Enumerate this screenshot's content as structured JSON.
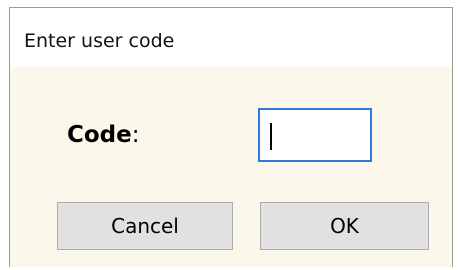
{
  "window": {
    "title": "Enter user code"
  },
  "form": {
    "code_label": "Code",
    "code_label_suffix": ":",
    "code_value": ""
  },
  "buttons": {
    "cancel_label": "Cancel",
    "ok_label": "OK"
  },
  "colors": {
    "dialog_background": "#fbf7ea",
    "titlebar_background": "#ffffff",
    "input_focus_border": "#2f7ad8",
    "button_background": "#e1e1e1",
    "button_border": "#acacac"
  }
}
